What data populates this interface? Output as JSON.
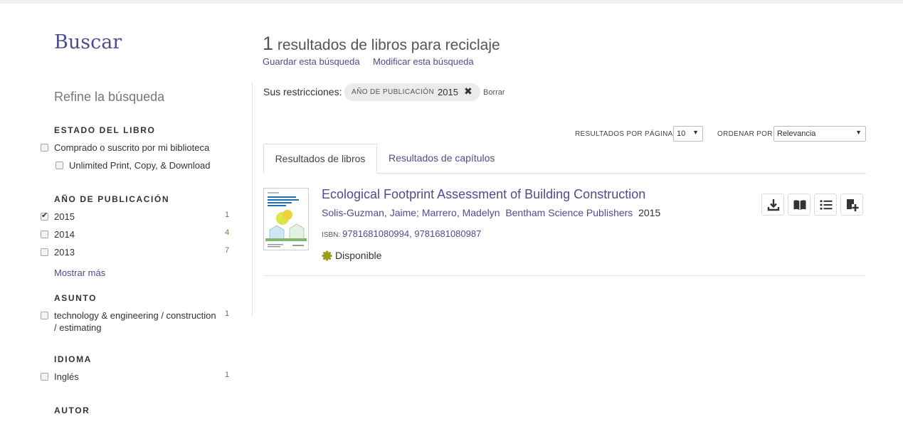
{
  "sidebar": {
    "title": "Buscar",
    "refine": "Refine la búsqueda",
    "estado": {
      "heading": "ESTADO DEL LIBRO",
      "options": [
        "Comprado o suscrito por mi biblioteca",
        "Unlimited Print, Copy, & Download"
      ]
    },
    "anio": {
      "heading": "AÑO DE PUBLICACIÓN",
      "options": [
        {
          "label": "2015",
          "count": "1",
          "checked": true
        },
        {
          "label": "2014",
          "count": "4",
          "checked": false
        },
        {
          "label": "2013",
          "count": "7",
          "checked": false
        }
      ],
      "more": "Mostrar más"
    },
    "asunto": {
      "heading": "ASUNTO",
      "options": [
        {
          "label": "technology & engineering / construction / estimating",
          "count": "1"
        }
      ]
    },
    "idioma": {
      "heading": "IDIOMA",
      "options": [
        {
          "label": "Inglés",
          "count": "1"
        }
      ]
    },
    "autor": {
      "heading": "AUTOR"
    }
  },
  "results": {
    "count": "1",
    "title_rest": "resultados de libros para reciclaje",
    "save_search": "Guardar esta búsqueda",
    "modify_search": "Modificar esta búsqueda",
    "restrictions_label": "Sus restricciones:",
    "chip": {
      "key": "AÑO DE PUBLICACIÓN",
      "value": "2015"
    },
    "clear": "Borrar",
    "per_page_label": "RESULTADOS POR PÁGINA",
    "per_page_value": "10",
    "sort_label": "ORDENAR POR",
    "sort_value": "Relevancia",
    "tabs": [
      "Resultados de libros",
      "Resultados de capítulos"
    ],
    "items": [
      {
        "title": "Ecological Footprint Assessment of Building Construction",
        "authors": "Solis-Guzman, Jaime; Marrero, Madelyn",
        "publisher": "Bentham Science Publishers",
        "year": "2015",
        "isbn_label": "ISBN:",
        "isbns": "9781681080994, 9781681080987",
        "status": "Disponible"
      }
    ]
  },
  "colors": {
    "accent": "#504c8f",
    "available": "#9a9a1c"
  },
  "icons": [
    "download-icon",
    "read-online-icon",
    "list-icon",
    "add-to-list-icon",
    "close-icon",
    "chevron-down-icon"
  ]
}
